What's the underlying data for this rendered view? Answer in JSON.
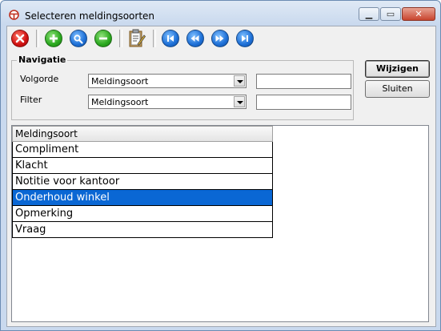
{
  "window": {
    "title": "Selecteren meldingsoorten"
  },
  "toolbar": {
    "buttons": [
      {
        "icon": "delete-icon",
        "color": "#d01010"
      },
      {
        "icon": "add-icon",
        "color": "#2aa81e"
      },
      {
        "icon": "search-icon",
        "color": "#1d6fd6"
      },
      {
        "icon": "remove-icon",
        "color": "#2aa81e"
      },
      {
        "icon": "clipboard-edit-icon"
      },
      {
        "icon": "first-record-icon",
        "color": "#1d6fd6"
      },
      {
        "icon": "previous-record-icon",
        "color": "#1d6fd6"
      },
      {
        "icon": "next-record-icon",
        "color": "#1d6fd6"
      },
      {
        "icon": "last-record-icon",
        "color": "#1d6fd6"
      }
    ]
  },
  "navigation": {
    "group_label": "Navigatie",
    "order_label": "Volgorde",
    "order_value": "Meldingsoort",
    "order_text": "",
    "filter_label": "Filter",
    "filter_value": "Meldingsoort",
    "filter_text": ""
  },
  "actions": {
    "edit_label": "Wijzigen",
    "close_label": "Sluiten"
  },
  "grid": {
    "header": "Meldingsoort",
    "rows": [
      "Compliment",
      "Klacht",
      "Notitie voor kantoor",
      "Onderhoud winkel",
      "Opmerking",
      "Vraag"
    ],
    "selected_row": "Onderhoud winkel",
    "selection_color": "#0a67d4"
  }
}
